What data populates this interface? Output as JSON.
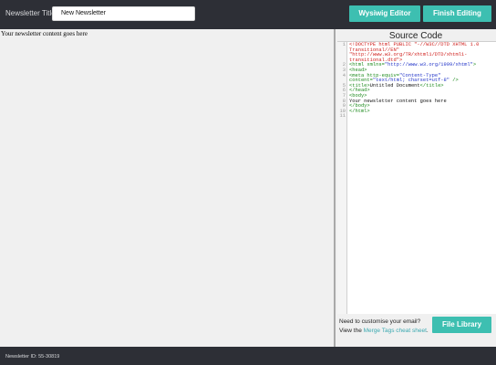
{
  "header": {
    "title_label": "Newsletter Title:",
    "title_value": "New Newsletter",
    "wysiwyg_label": "Wysiwig Editor",
    "finish_label": "Finish Editing"
  },
  "editor": {
    "content": "Your newsletter content goes here"
  },
  "source": {
    "title": "Source Code",
    "lines": [
      {
        "n": "1",
        "parts": [
          {
            "t": "<!DOCTYPE html PUBLIC \"-//W3C//DTD XHTML 1.0 Transitional//EN\" \"http://www.w3.org/TR/xhtml1/DTD/xhtml1-transitional.dtd\">",
            "c": "c-doctype"
          }
        ]
      },
      {
        "n": "2",
        "parts": [
          {
            "t": "<html ",
            "c": "c-tag"
          },
          {
            "t": "xmlns=",
            "c": "c-attr"
          },
          {
            "t": "\"http://www.w3.org/1999/xhtml\"",
            "c": "c-str"
          },
          {
            "t": ">",
            "c": "c-tag"
          }
        ]
      },
      {
        "n": "3",
        "parts": [
          {
            "t": "<head>",
            "c": "c-tag"
          }
        ]
      },
      {
        "n": "4",
        "parts": [
          {
            "t": "<meta ",
            "c": "c-tag"
          },
          {
            "t": "http-equiv=",
            "c": "c-attr"
          },
          {
            "t": "\"Content-Type\"",
            "c": "c-str"
          },
          {
            "t": " content=",
            "c": "c-attr"
          },
          {
            "t": "\"text/html; charset=utf-8\"",
            "c": "c-str"
          },
          {
            "t": " />",
            "c": "c-tag"
          }
        ]
      },
      {
        "n": "5",
        "parts": [
          {
            "t": "<title>",
            "c": "c-tag"
          },
          {
            "t": "Untitled Document",
            "c": "c-text"
          },
          {
            "t": "</title>",
            "c": "c-tag"
          }
        ]
      },
      {
        "n": "6",
        "parts": [
          {
            "t": "</head>",
            "c": "c-tag"
          }
        ]
      },
      {
        "n": "7",
        "parts": [
          {
            "t": "<body>",
            "c": "c-tag"
          }
        ]
      },
      {
        "n": "8",
        "parts": [
          {
            "t": "Your newsletter content goes here",
            "c": "c-text"
          }
        ]
      },
      {
        "n": "9",
        "parts": [
          {
            "t": "</body>",
            "c": "c-tag"
          }
        ]
      },
      {
        "n": "10",
        "parts": [
          {
            "t": "</html>",
            "c": "c-tag"
          }
        ]
      },
      {
        "n": "11",
        "parts": []
      }
    ]
  },
  "help": {
    "line1": "Need to customise your email?",
    "line2_prefix": "View the ",
    "link": "Merge Tags cheat sheet",
    "line2_suffix": "."
  },
  "file_library_label": "File Library",
  "footer": {
    "newsletter_id": "Newsletter ID: 55-30819"
  }
}
